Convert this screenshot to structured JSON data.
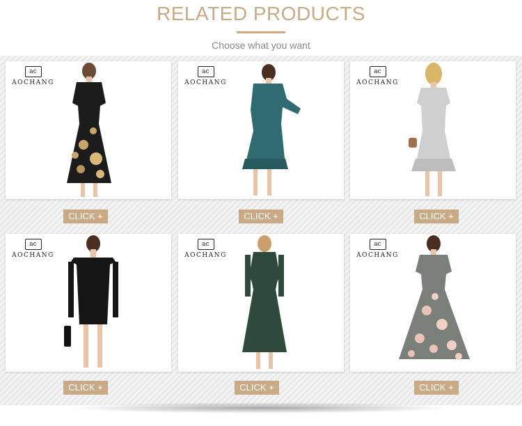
{
  "header": {
    "title": "RELATED PRODUCTS",
    "subtitle": "Choose what you want"
  },
  "brand": {
    "mark": "ac",
    "name": "AOCHANG"
  },
  "colors": {
    "accent": "#c9aa86",
    "subtitle": "#8a8a8a"
  },
  "products": [
    {
      "name": "floral-wrap-dress",
      "button": "CLICK +"
    },
    {
      "name": "teal-satin-wrap-dress",
      "button": "CLICK +"
    },
    {
      "name": "speckled-ruffle-dress",
      "button": "CLICK +"
    },
    {
      "name": "black-off-shoulder-dress",
      "button": "CLICK +"
    },
    {
      "name": "green-glitter-midi-dress",
      "button": "CLICK +"
    },
    {
      "name": "gray-floral-maxi-dress",
      "button": "CLICK +"
    }
  ]
}
